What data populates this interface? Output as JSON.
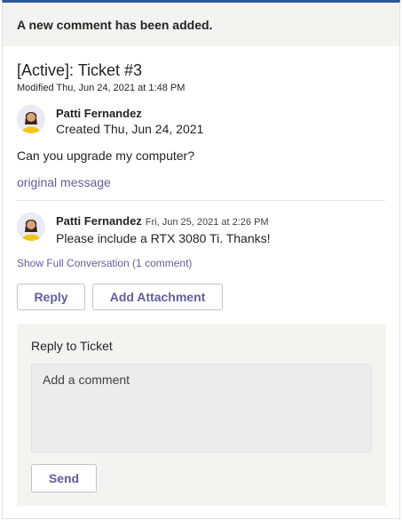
{
  "banner": {
    "text": "A new comment has been added."
  },
  "ticket": {
    "title": "[Active]: Ticket #3",
    "modified": "Modified Thu, Jun 24, 2021 at 1:48 PM"
  },
  "original": {
    "author": "Patti Fernandez",
    "created": "Created Thu, Jun 24, 2021",
    "message": "Can you upgrade my computer?",
    "link": "original message"
  },
  "comment": {
    "author": "Patti Fernandez",
    "timestamp": "Fri, Jun 25, 2021 at 2:26 PM",
    "text": "Please include a RTX 3080 Ti. Thanks!"
  },
  "conversation_link": "Show Full Conversation (1 comment)",
  "actions": {
    "reply": "Reply",
    "add_attachment": "Add Attachment"
  },
  "reply_panel": {
    "title": "Reply to Ticket",
    "placeholder": "Add a comment",
    "send": "Send"
  },
  "colors": {
    "accent": "#2b5797",
    "link": "#5f5f9e",
    "panel_bg": "#f5f3f0"
  }
}
